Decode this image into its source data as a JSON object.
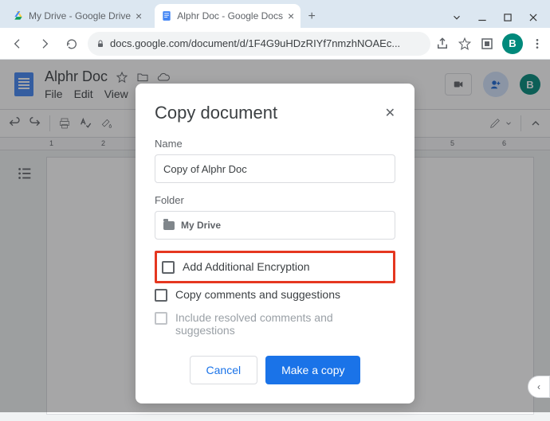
{
  "window": {
    "tabs": [
      {
        "title": "My Drive - Google Drive"
      },
      {
        "title": "Alphr Doc - Google Docs"
      }
    ],
    "avatar_letter": "B"
  },
  "address_bar": {
    "url": "docs.google.com/document/d/1F4G9uHDzRIYf7nmzhNOAEc..."
  },
  "docs": {
    "title": "Alphr Doc",
    "menus": [
      "File",
      "Edit",
      "View"
    ],
    "ruler_numbers": [
      "1",
      "2",
      "5",
      "6"
    ],
    "avatar_letter": "B"
  },
  "modal": {
    "title": "Copy document",
    "labels": {
      "name": "Name",
      "folder": "Folder"
    },
    "name_value": "Copy of Alphr Doc",
    "folder_value": "My Drive",
    "checkboxes": {
      "add_encryption": "Add Additional Encryption",
      "copy_comments": "Copy comments and suggestions",
      "include_resolved": "Include resolved comments and suggestions"
    },
    "buttons": {
      "cancel": "Cancel",
      "make_copy": "Make a copy"
    }
  }
}
